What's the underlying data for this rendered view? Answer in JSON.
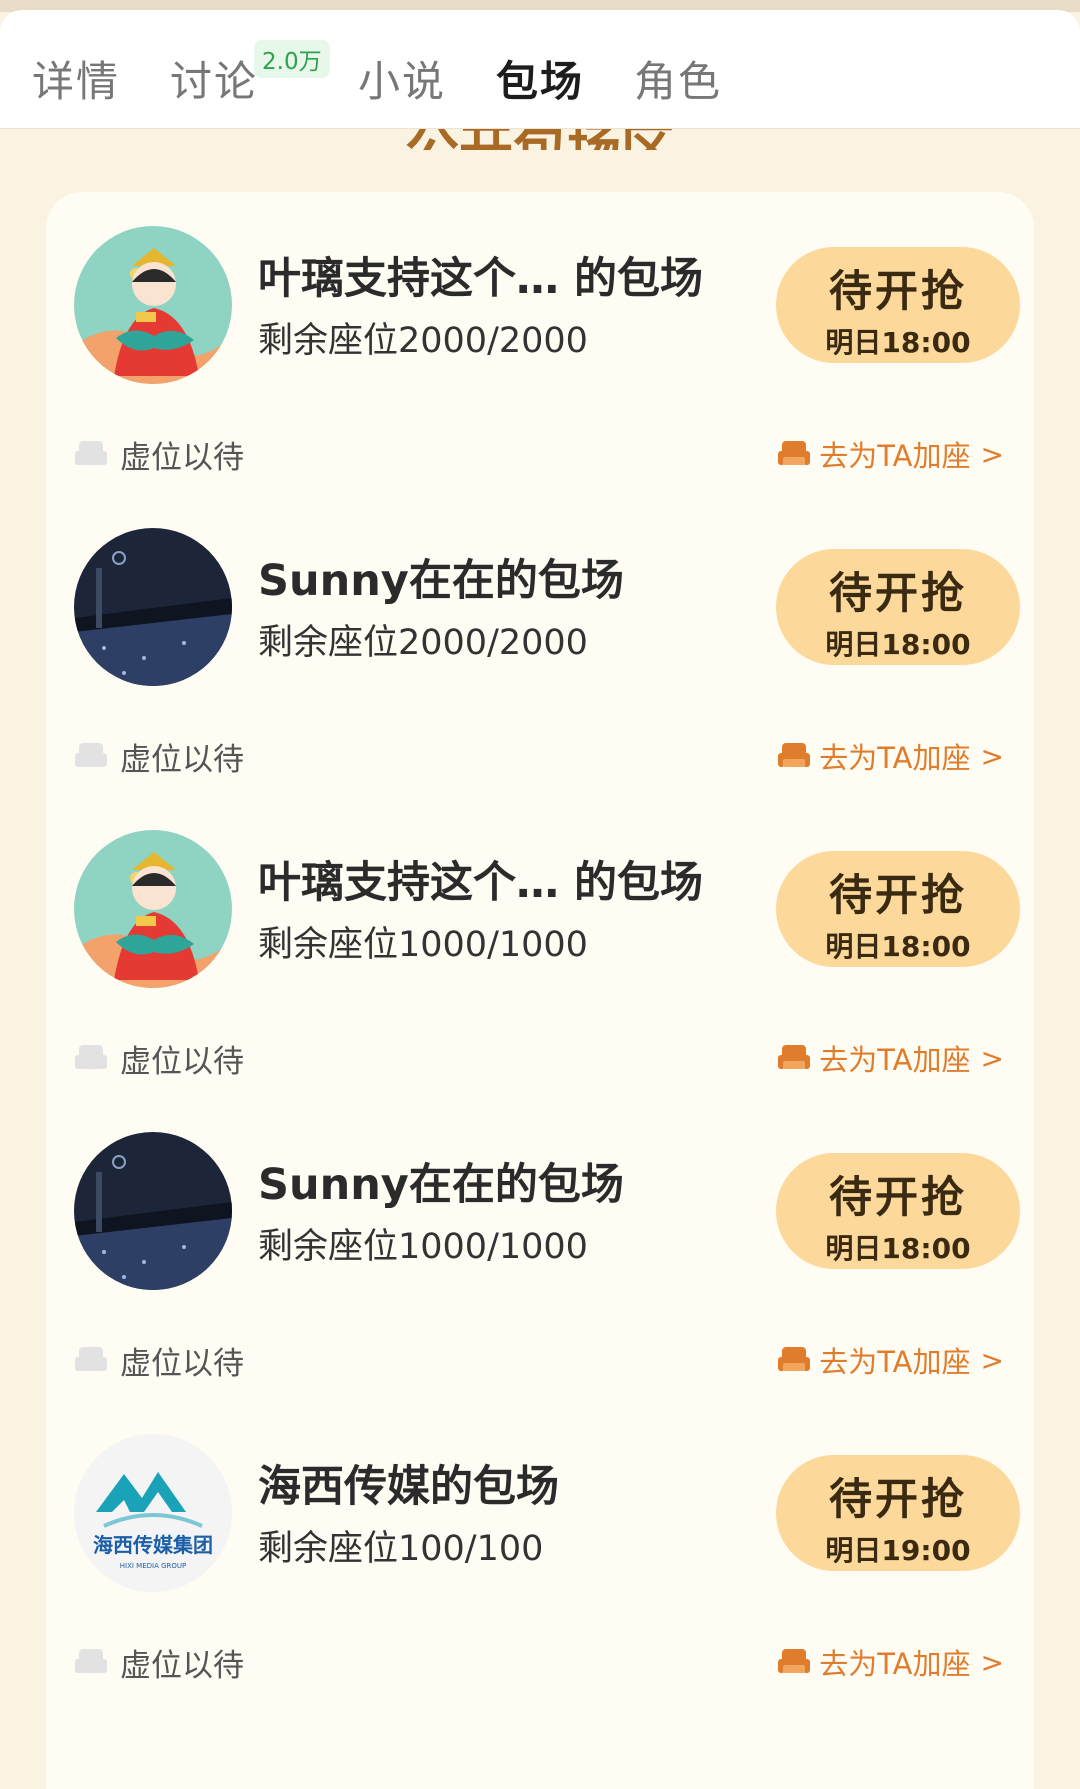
{
  "tabs": [
    {
      "label": "详情"
    },
    {
      "label": "讨论",
      "badge": "2.0万"
    },
    {
      "label": "小说"
    },
    {
      "label": "包场"
    },
    {
      "label": "角色"
    }
  ],
  "section_title": "公开包场区",
  "items": [
    {
      "title": "叶璃支持这个…   的包场",
      "seats": "剩余座位2000/2000",
      "button": "待开抢",
      "time": "明日18:00",
      "waiting": "虚位以待",
      "add_seat": "去为TA加座",
      "avatar": "opera-character-avatar"
    },
    {
      "title": "Sunny在在的包场",
      "seats": "剩余座位2000/2000",
      "button": "待开抢",
      "time": "明日18:00",
      "waiting": "虚位以待",
      "add_seat": "去为TA加座",
      "avatar": "night-sea-avatar"
    },
    {
      "title": "叶璃支持这个…   的包场",
      "seats": "剩余座位1000/1000",
      "button": "待开抢",
      "time": "明日18:00",
      "waiting": "虚位以待",
      "add_seat": "去为TA加座",
      "avatar": "opera-character-avatar"
    },
    {
      "title": "Sunny在在的包场",
      "seats": "剩余座位1000/1000",
      "button": "待开抢",
      "time": "明日18:00",
      "waiting": "虚位以待",
      "add_seat": "去为TA加座",
      "avatar": "night-sea-avatar"
    },
    {
      "title": "海西传媒的包场",
      "seats": "剩余座位100/100",
      "button": "待开抢",
      "time": "明日19:00",
      "waiting": "虚位以待",
      "add_seat": "去为TA加座",
      "avatar": "haixi-media-logo",
      "logo_text": "海西传媒集团",
      "logo_sub": "HIXI MEDIA GROUP"
    }
  ],
  "colors": {
    "accent": "#e07d2d",
    "button_bg": "#fcd89a",
    "badge_green": "#2ea24f",
    "page_bg": "#fbf3e2"
  }
}
